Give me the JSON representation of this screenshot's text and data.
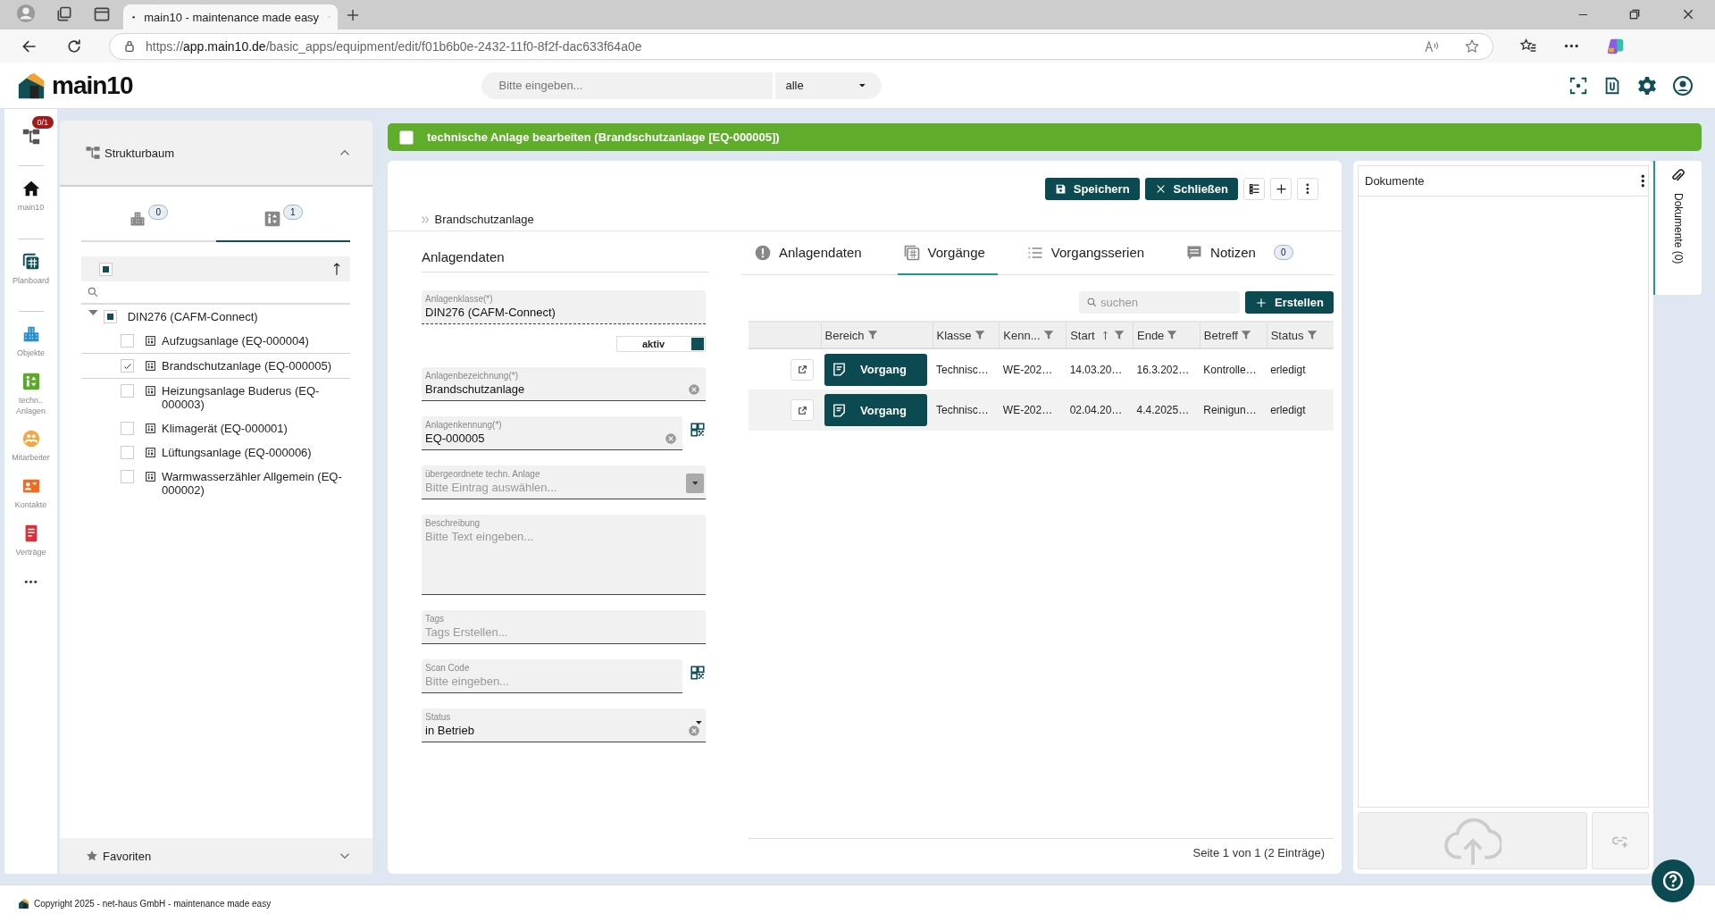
{
  "browser": {
    "tabs": [
      {
        "title": "main10 - maintenance made easy",
        "selected": true
      }
    ],
    "url": {
      "scheme": "https://",
      "host": "app.main10.de",
      "path": "/basic_apps/equipment/edit/f01b6b0e-2432-11f0-8f2f-dac633f64a0e"
    }
  },
  "header": {
    "logo": "main10",
    "search": {
      "placeholder": "Bitte eingeben..."
    },
    "scope": "alle"
  },
  "nav": {
    "badge": "0/1",
    "items": [
      {
        "label": "main10"
      },
      {
        "label": "Planboard"
      },
      {
        "label": "Objekte"
      },
      {
        "label": "techn.. Anlagen"
      },
      {
        "label": "Mitarbeiter"
      },
      {
        "label": "Kontakte"
      },
      {
        "label": "Verträge"
      }
    ]
  },
  "structure": {
    "title": "Strukturbaum",
    "expanded": true,
    "tabs": [
      {
        "count": "0",
        "selected": false
      },
      {
        "count": "1",
        "selected": true
      }
    ],
    "select_all": {
      "indeterminate": true
    },
    "tree": [
      {
        "label": "DIN276 (CAFM-Connect)",
        "expanded": true,
        "indeterminate": true,
        "children": [
          {
            "label": "Aufzugsanlage (EQ-000004)",
            "checked": false,
            "selected": false
          },
          {
            "label": "Brandschutzanlage (EQ-000005)",
            "checked": true,
            "selected": true
          },
          {
            "label": "Heizungsanlage Buderus (EQ-000003)",
            "checked": false,
            "selected": false
          },
          {
            "label": "Klimagerät (EQ-000001)",
            "checked": false,
            "selected": false
          },
          {
            "label": "Lüftungsanlage (EQ-000006)",
            "checked": false,
            "selected": false
          },
          {
            "label": "Warmwasserzähler Allgemein (EQ-000002)",
            "checked": false,
            "selected": false
          }
        ]
      }
    ]
  },
  "favorites": {
    "title": "Favoriten",
    "expanded": false
  },
  "page": {
    "title": "technische Anlage bearbeiten (Brandschutzanlage [EQ-000005])",
    "buttons": [
      {
        "label": "Speichern"
      },
      {
        "label": "Schließen"
      }
    ],
    "breadcrumb": "Brandschutzanlage"
  },
  "form": {
    "title": "Anlagendaten",
    "fields": [
      {
        "kind": "readonly",
        "label": "Anlagenklasse(*)",
        "value": "DIN276 (CAFM-Connect)"
      },
      {
        "kind": "toggle",
        "label": "aktiv",
        "on": true
      },
      {
        "kind": "text",
        "label": "Anlagenbezeichnung(*)",
        "value": "Brandschutzanlage",
        "clearable": true
      },
      {
        "kind": "text",
        "label": "Anlagenkennung(*)",
        "value": "EQ-000005",
        "clearable": true,
        "qr": true
      },
      {
        "kind": "select",
        "label": "übergeordnete techn. Anlage",
        "placeholder": "Bitte Eintrag auswählen..."
      },
      {
        "kind": "textarea",
        "label": "Beschreibung",
        "placeholder": "Bitte Text eingeben..."
      },
      {
        "kind": "text",
        "label": "Tags",
        "placeholder": "Tags Erstellen..."
      },
      {
        "kind": "text",
        "label": "Scan Code",
        "placeholder": "Bitte eingeben...",
        "qr": true
      },
      {
        "kind": "status",
        "label": "Status",
        "value": "in Betrieb",
        "clearable": true
      }
    ]
  },
  "tabs": [
    {
      "label": "Anlagendaten",
      "selected": false
    },
    {
      "label": "Vorgänge",
      "selected": true
    },
    {
      "label": "Vorgangsserien",
      "selected": false
    },
    {
      "label": "Notizen",
      "count": "0",
      "selected": false
    }
  ],
  "table": {
    "search": {
      "placeholder": "suchen"
    },
    "create": "Erstellen",
    "columns": [
      {
        "label": "Bereich",
        "sorted": false
      },
      {
        "label": "Klasse",
        "sorted": false
      },
      {
        "label": "Kenn...",
        "sorted": false
      },
      {
        "label": "Start",
        "sorted": true
      },
      {
        "label": "Ende",
        "sorted": false
      },
      {
        "label": "Betreff",
        "sorted": false
      },
      {
        "label": "Status",
        "sorted": false
      }
    ],
    "rows": [
      {
        "cells": [
          "Vorgang",
          "Technisc…",
          "WE-202…",
          "14.03.20…",
          "16.3.202…",
          "Kontrolle…",
          "erledigt"
        ]
      },
      {
        "cells": [
          "Vorgang",
          "Technisc…",
          "WE-202…",
          "02.04.20…",
          "4.4.2025…",
          "Reinigun…",
          "erledigt"
        ]
      }
    ],
    "pager": "Seite 1 von 1 (2 Einträge)"
  },
  "documents": {
    "title": "Dokumente",
    "tab": "Dokumente (0)"
  },
  "footer": "Copyright 2025 - net-haus GmbH - maintenance made easy"
}
